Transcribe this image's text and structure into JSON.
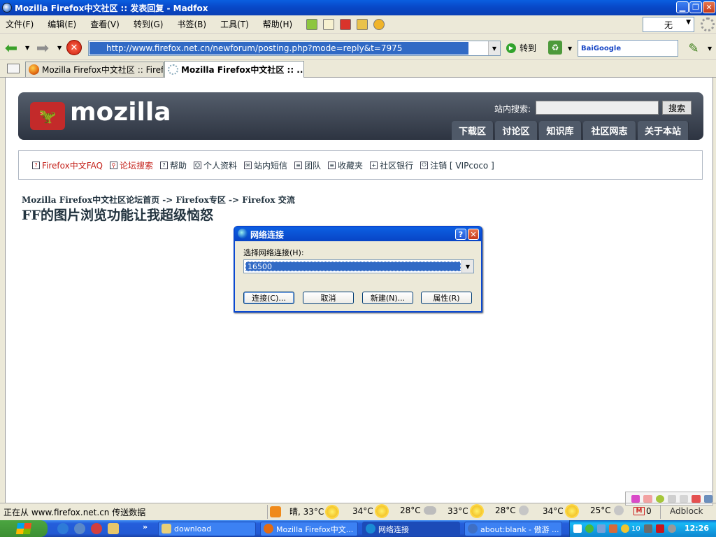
{
  "window": {
    "title": "Mozilla Firefox中文社区 :: 发表回复 - Madfox"
  },
  "menubar": {
    "items": [
      "文件(F)",
      "编辑(E)",
      "查看(V)",
      "转到(G)",
      "书签(B)",
      "工具(T)",
      "帮助(H)"
    ],
    "zoom_select": "无"
  },
  "navbar": {
    "url": "http://www.firefox.net.cn/newforum/posting.php?mode=reply&t=7975",
    "go_label": "转到",
    "search_engine_label": "BaiGoogle"
  },
  "tabs": [
    {
      "label": "Mozilla Firefox中文社区 :: Firef...",
      "active": false
    },
    {
      "label": "Mozilla Firefox中文社区 :: ...",
      "active": true
    }
  ],
  "page": {
    "logo_text": "mozilla",
    "search_label": "站内搜索:",
    "search_button": "搜索",
    "banner_tabs": [
      "下载区",
      "讨论区",
      "知识库",
      "社区网志",
      "关于本站"
    ],
    "nav_links": [
      "Firefox中文FAQ",
      "论坛搜索",
      "帮助",
      "个人资料",
      "站内短信",
      "团队",
      "收藏夹",
      "社区银行",
      "注销 [ VIPcoco ]"
    ],
    "breadcrumb": "Mozilla Firefox中文社区论坛首页  -> Firefox专区 -> Firefox 交流",
    "post_title": "FF的图片浏览功能让我超级恼怒"
  },
  "dialog": {
    "title": "网络连接",
    "label": "选择网络连接(H):",
    "selected_connection": "16500",
    "buttons": {
      "connect": "连接(C)...",
      "cancel": "取消",
      "new": "新建(N)...",
      "properties": "属性(R)"
    }
  },
  "statusbar": {
    "text": "正在从 www.firefox.net.cn 传送数据",
    "weather": [
      {
        "text": "晴, 33°C",
        "icon": "sun-icon"
      },
      {
        "text": "34°C",
        "icon": "sun-icon"
      },
      {
        "text": "28°C",
        "icon": "cloud-icon"
      },
      {
        "text": "33°C",
        "icon": "sun-icon"
      },
      {
        "text": "28°C",
        "icon": "moon-icon"
      },
      {
        "text": "34°C",
        "icon": "sun-icon"
      },
      {
        "text": "25°C",
        "icon": "moon-icon"
      }
    ],
    "mail_count": "0",
    "adblock_label": "Adblock"
  },
  "taskbar": {
    "tasks": [
      "download",
      "Mozilla Firefox中文...",
      "网络连接",
      "about:blank - 傲游 ..."
    ],
    "tray_badge": "10",
    "clock": "12:26"
  },
  "colors": {
    "titlebar": "#0a5ee0",
    "selection": "#316ac5",
    "banner": "#3a4352",
    "link_red": "#c4211a",
    "taskbar": "#245edb",
    "start_green": "#3c8f33"
  }
}
